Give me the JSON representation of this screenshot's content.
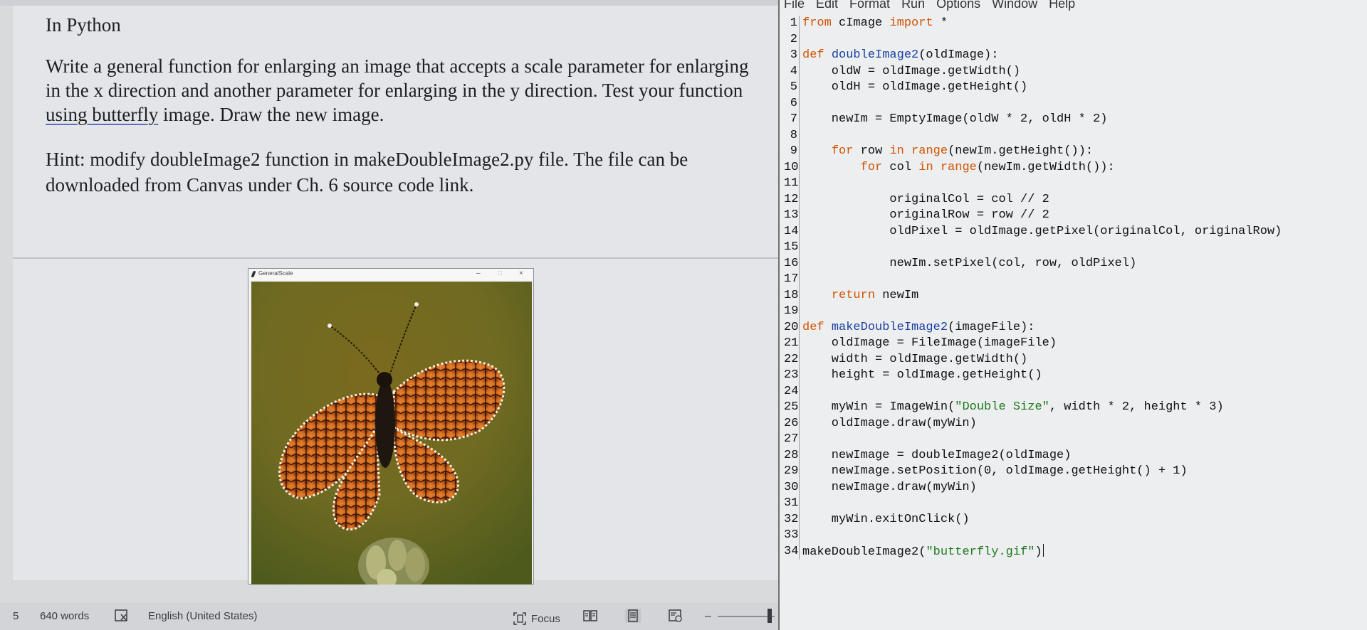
{
  "word": {
    "doc": {
      "heading": "In Python",
      "para1_before": "Write a general function for enlarging an image that accepts a scale parameter for enlarging in the x direction and another parameter for enlarging in the y direction. Test your function ",
      "para1_flagged": "using  butterfly",
      "para1_after": " image. Draw the new image.",
      "para2": "Hint: modify doubleImage2 function in makeDoubleImage2.py file. The file can be downloaded from Canvas under Ch. 6 source code link."
    },
    "image_window": {
      "title": "GeneralScale",
      "minimize": "–",
      "maximize": "□",
      "close": "×"
    },
    "status": {
      "page": "5",
      "words": "640 words",
      "language": "English (United States)",
      "focus": "Focus",
      "zoom_minus": "–"
    },
    "colors": {
      "idle_keyword": "#d35400",
      "idle_function_name": "#1a3fa0",
      "idle_string": "#1d7a1d"
    }
  },
  "idle": {
    "menu": [
      "File",
      "Edit",
      "Format",
      "Run",
      "Options",
      "Window",
      "Help"
    ],
    "lines": [
      {
        "n": "1",
        "parts": [
          [
            "kw",
            "from"
          ],
          [
            "t",
            " cImage "
          ],
          [
            "kw",
            "import"
          ],
          [
            "t",
            " *"
          ]
        ]
      },
      {
        "n": "2",
        "parts": []
      },
      {
        "n": "3",
        "parts": [
          [
            "kw",
            "def"
          ],
          [
            "t",
            " "
          ],
          [
            "fn",
            "doubleImage2"
          ],
          [
            "t",
            "(oldImage):"
          ]
        ]
      },
      {
        "n": "4",
        "parts": [
          [
            "t",
            "    oldW = oldImage.getWidth()"
          ]
        ]
      },
      {
        "n": "5",
        "parts": [
          [
            "t",
            "    oldH = oldImage.getHeight()"
          ]
        ]
      },
      {
        "n": "6",
        "parts": []
      },
      {
        "n": "7",
        "parts": [
          [
            "t",
            "    newIm = EmptyImage(oldW * 2, oldH * 2)"
          ]
        ]
      },
      {
        "n": "8",
        "parts": []
      },
      {
        "n": "9",
        "parts": [
          [
            "t",
            "    "
          ],
          [
            "kw",
            "for"
          ],
          [
            "t",
            " row "
          ],
          [
            "kw",
            "in"
          ],
          [
            "t",
            " "
          ],
          [
            "kw",
            "range"
          ],
          [
            "t",
            "(newIm.getHeight()):"
          ]
        ]
      },
      {
        "n": "10",
        "parts": [
          [
            "t",
            "        "
          ],
          [
            "kw",
            "for"
          ],
          [
            "t",
            " col "
          ],
          [
            "kw",
            "in"
          ],
          [
            "t",
            " "
          ],
          [
            "kw",
            "range"
          ],
          [
            "t",
            "(newIm.getWidth()):"
          ]
        ]
      },
      {
        "n": "11",
        "parts": []
      },
      {
        "n": "12",
        "parts": [
          [
            "t",
            "            originalCol = col // 2"
          ]
        ]
      },
      {
        "n": "13",
        "parts": [
          [
            "t",
            "            originalRow = row // 2"
          ]
        ]
      },
      {
        "n": "14",
        "parts": [
          [
            "t",
            "            oldPixel = oldImage.getPixel(originalCol, originalRow)"
          ]
        ]
      },
      {
        "n": "15",
        "parts": []
      },
      {
        "n": "16",
        "parts": [
          [
            "t",
            "            newIm.setPixel(col, row, oldPixel)"
          ]
        ]
      },
      {
        "n": "17",
        "parts": []
      },
      {
        "n": "18",
        "parts": [
          [
            "t",
            "    "
          ],
          [
            "kw",
            "return"
          ],
          [
            "t",
            " newIm"
          ]
        ]
      },
      {
        "n": "19",
        "parts": []
      },
      {
        "n": "20",
        "parts": [
          [
            "kw",
            "def"
          ],
          [
            "t",
            " "
          ],
          [
            "fn",
            "makeDoubleImage2"
          ],
          [
            "t",
            "(imageFile):"
          ]
        ]
      },
      {
        "n": "21",
        "parts": [
          [
            "t",
            "    oldImage = FileImage(imageFile)"
          ]
        ]
      },
      {
        "n": "22",
        "parts": [
          [
            "t",
            "    width = oldImage.getWidth()"
          ]
        ]
      },
      {
        "n": "23",
        "parts": [
          [
            "t",
            "    height = oldImage.getHeight()"
          ]
        ]
      },
      {
        "n": "24",
        "parts": []
      },
      {
        "n": "25",
        "parts": [
          [
            "t",
            "    myWin = ImageWin("
          ],
          [
            "str",
            "\"Double Size\""
          ],
          [
            "t",
            ", width * 2, height * 3)"
          ]
        ]
      },
      {
        "n": "26",
        "parts": [
          [
            "t",
            "    oldImage.draw(myWin)"
          ]
        ]
      },
      {
        "n": "27",
        "parts": []
      },
      {
        "n": "28",
        "parts": [
          [
            "t",
            "    newImage = doubleImage2(oldImage)"
          ]
        ]
      },
      {
        "n": "29",
        "parts": [
          [
            "t",
            "    newImage.setPosition(0, oldImage.getHeight() + 1)"
          ]
        ]
      },
      {
        "n": "30",
        "parts": [
          [
            "t",
            "    newImage.draw(myWin)"
          ]
        ]
      },
      {
        "n": "31",
        "parts": []
      },
      {
        "n": "32",
        "parts": [
          [
            "t",
            "    myWin.exitOnClick()"
          ]
        ]
      },
      {
        "n": "33",
        "parts": []
      },
      {
        "n": "34",
        "parts": [
          [
            "t",
            "makeDoubleImage2("
          ],
          [
            "str",
            "\"butterfly.gif\""
          ],
          [
            "t",
            ")"
          ]
        ]
      }
    ]
  }
}
